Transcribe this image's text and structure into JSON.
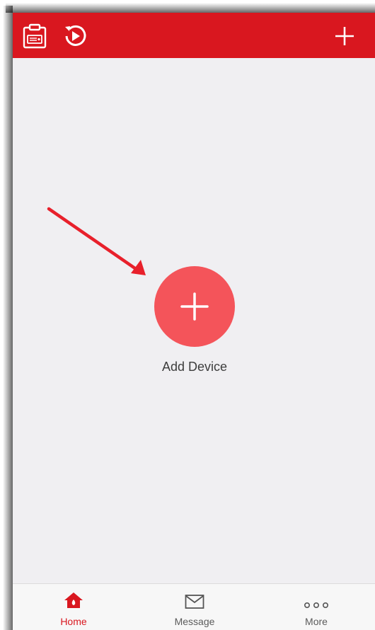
{
  "colors": {
    "brand": "#d9171f",
    "add_button": "#f4545a",
    "background": "#f0eff2",
    "annotation_arrow": "#e8202b"
  },
  "topbar": {
    "icons": [
      "clipboard-icon",
      "playback-icon",
      "plus-icon"
    ]
  },
  "main": {
    "add_device_label": "Add Device",
    "add_icon": "plus-icon"
  },
  "tabs": [
    {
      "label": "Home",
      "icon": "home-icon",
      "active": true
    },
    {
      "label": "Message",
      "icon": "envelope-icon",
      "active": false
    },
    {
      "label": "More",
      "icon": "more-dots-icon",
      "active": false
    }
  ]
}
